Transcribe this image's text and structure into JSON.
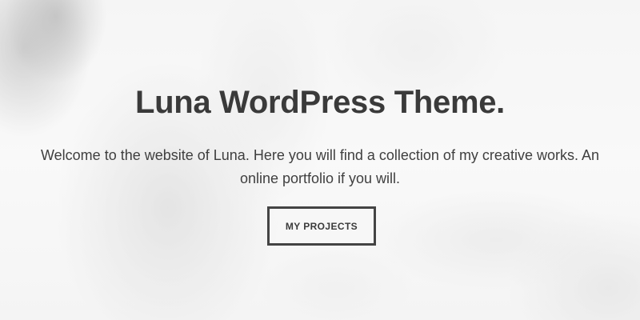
{
  "hero": {
    "title": "Luna WordPress Theme.",
    "description": "Welcome to the website of Luna. Here you will find a collection of my creative works. An online portfolio if you will.",
    "button_label": "MY PROJECTS"
  },
  "colors": {
    "text": "#3a3a3a",
    "button_border": "#444444",
    "background": "#f4f4f4"
  }
}
